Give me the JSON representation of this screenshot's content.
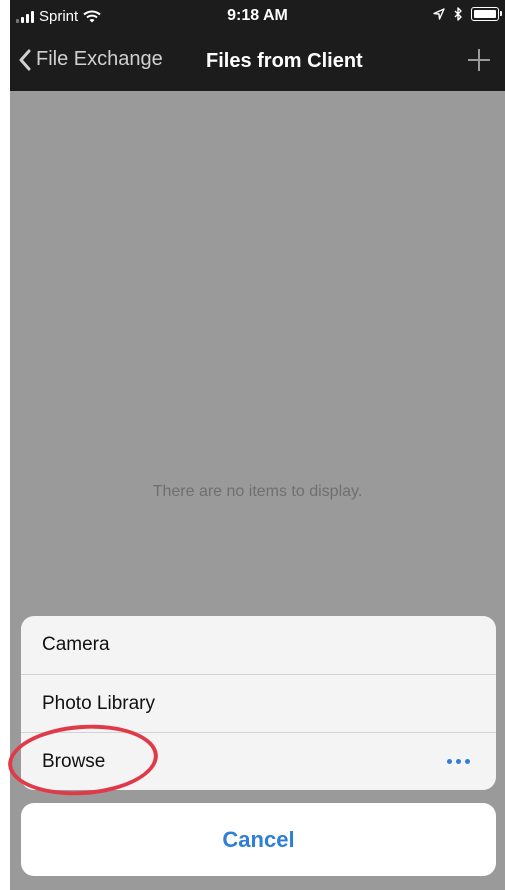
{
  "status_bar": {
    "carrier": "Sprint",
    "time": "9:18 AM",
    "icons": [
      "signal-icon",
      "wifi-icon",
      "location-icon",
      "bluetooth-icon",
      "battery-icon"
    ]
  },
  "nav": {
    "back_label": "File Exchange",
    "title": "Files from Client",
    "add_icon": "plus-icon"
  },
  "content": {
    "empty_message": "There are no items to display."
  },
  "action_sheet": {
    "options": [
      {
        "label": "Camera"
      },
      {
        "label": "Photo Library"
      },
      {
        "label": "Browse",
        "icon": "more-icon"
      }
    ],
    "cancel_label": "Cancel"
  },
  "colors": {
    "accent": "#2f7fd6",
    "bar_background": "#1c1c1c",
    "dim_overlay": "#9a9a9a",
    "highlight": "#e03a48"
  }
}
